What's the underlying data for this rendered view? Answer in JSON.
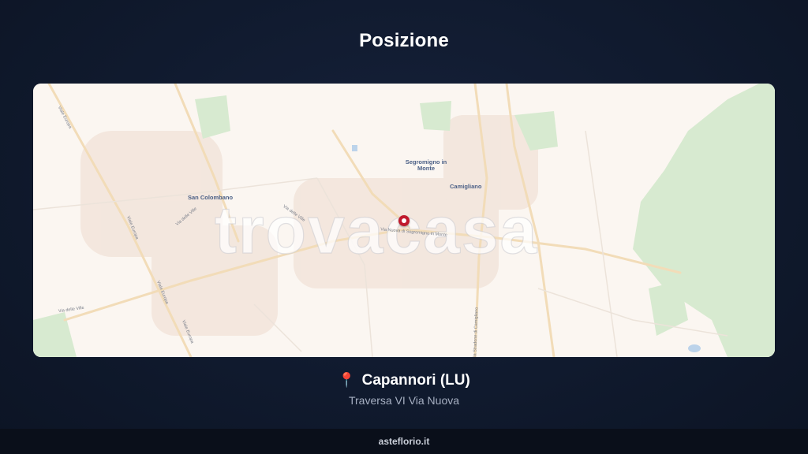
{
  "header": {
    "title": "Posizione"
  },
  "map": {
    "watermark": "trovacasa",
    "places": {
      "segromigno": "Segromigno in Monte",
      "camigliano": "Camigliano",
      "san_colombano": "San Colombano"
    },
    "streets": {
      "viale_europa_1": "Viale Europa",
      "viale_europa_2": "Viale Europa",
      "viale_europa_3": "Viale Europa",
      "viale_europa_4": "Viale Europa",
      "via_delle_ville_1": "Via delle Ville",
      "via_delle_ville_2": "Via delle Ville",
      "via_delle_ville_3": "Via delle Ville",
      "via_nuova": "Via Nuova di Segromigno in Monte",
      "via_stradone": "Via Stradone di Camigliano"
    },
    "colors": {
      "land": "#fbf6f1",
      "park": "#d7ead0",
      "road": "#f5e6c8",
      "pin": "#c0192c"
    }
  },
  "location": {
    "icon": "map-pin-icon",
    "name": "Capannori (LU)",
    "address": "Traversa VI Via Nuova"
  },
  "footer": {
    "brand": "asteflorio.it"
  }
}
